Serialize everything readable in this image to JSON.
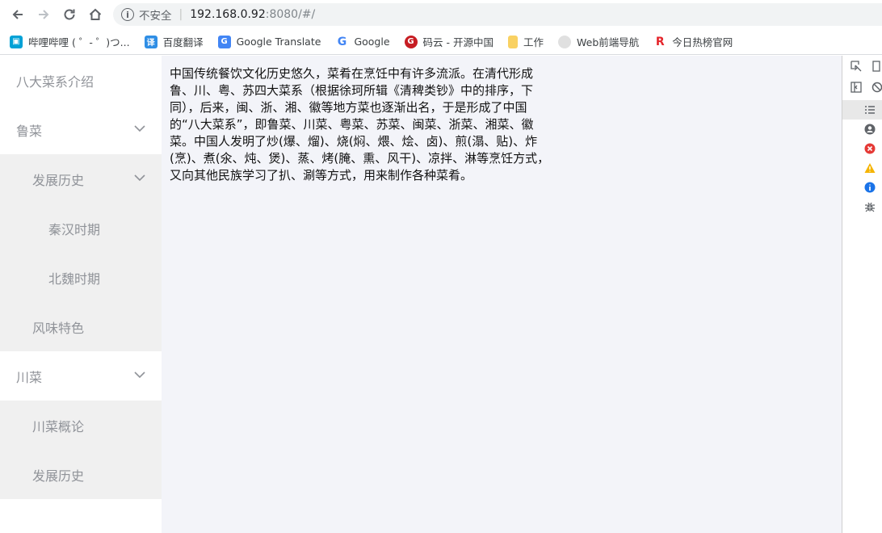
{
  "browser": {
    "security_label": "不安全",
    "url_host": "192.168.0.92",
    "url_rest": ":8080/#/",
    "bookmarks": [
      {
        "label": "哔哩哔哩 ( ゜- ゜)つ...",
        "icon": "bilibili-icon",
        "color": "#00a1d6"
      },
      {
        "label": "百度翻译",
        "icon": "translate-icon",
        "color": "#2f8ee5"
      },
      {
        "label": "Google Translate",
        "icon": "google-translate-icon",
        "color": "#4285f4"
      },
      {
        "label": "Google",
        "icon": "google-icon",
        "color": "#4285f4"
      },
      {
        "label": "码云 - 开源中国",
        "icon": "gitee-icon",
        "color": "#c71d23"
      },
      {
        "label": "工作",
        "icon": "folder-icon",
        "color": "#f9d162"
      },
      {
        "label": "Web前端导航",
        "icon": "web-nav-icon",
        "color": "#bdbdbd"
      },
      {
        "label": "今日热榜官网",
        "icon": "hot-list-icon",
        "color": "#e5262c"
      }
    ]
  },
  "sidebar": {
    "items": [
      {
        "label": "八大菜系介绍",
        "level": 1,
        "has_chevron": false
      },
      {
        "label": "鲁菜",
        "level": 1,
        "has_chevron": true,
        "expanded": true
      },
      {
        "label": "发展历史",
        "level": 2,
        "has_chevron": true,
        "expanded": true
      },
      {
        "label": "秦汉时期",
        "level": 3,
        "has_chevron": false
      },
      {
        "label": "北魏时期",
        "level": 3,
        "has_chevron": false
      },
      {
        "label": "风味特色",
        "level": 2,
        "has_chevron": false
      },
      {
        "label": "川菜",
        "level": 1,
        "has_chevron": true,
        "expanded": true
      },
      {
        "label": "川菜概论",
        "level": 2,
        "has_chevron": false
      },
      {
        "label": "发展历史",
        "level": 2,
        "has_chevron": false
      }
    ]
  },
  "content": {
    "lines": [
      "中国传统餐饮文化历史悠久，菜肴在烹饪中有许多流派。在清代形成",
      "鲁、川、粤、苏四大菜系（根据徐珂所辑《清稗类钞》中的排序，下",
      "同），后来，闽、浙、湘、徽等地方菜也逐渐出名，于是形成了中国",
      "的“八大菜系”，即鲁菜、川菜、粤菜、苏菜、闽菜、浙菜、湘菜、徽",
      "菜。中国人发明了炒(爆、熘)、烧(焖、煨、烩、卤)、煎(溻、贴)、炸",
      "(烹)、煮(氽、炖、煲)、蒸、烤(腌、熏、风干)、凉拌、淋等烹饪方式，",
      "又向其他民族学习了扒、涮等方式，用来制作各种菜肴。"
    ]
  },
  "colors": {
    "content_bg": "#f3f4f9",
    "submenu_bg": "#f0f0f0",
    "menu_text": "#909399"
  }
}
